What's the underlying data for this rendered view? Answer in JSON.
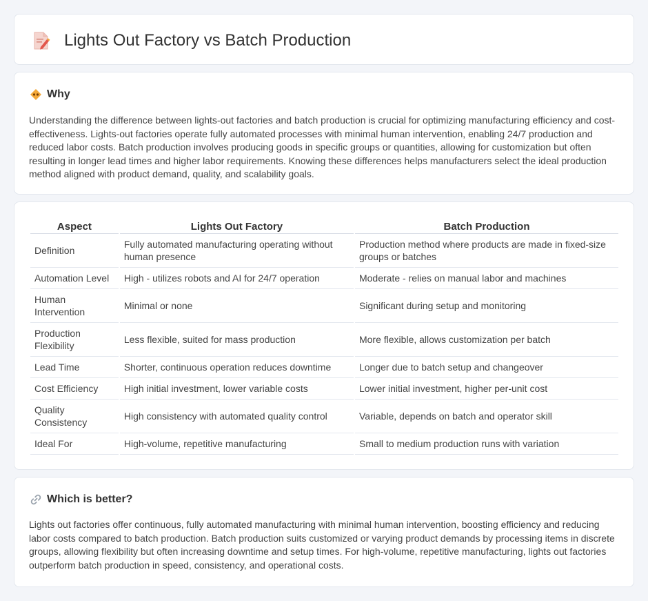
{
  "header": {
    "title": "Lights Out Factory vs Batch Production",
    "icon": "document-pencil-icon"
  },
  "why": {
    "icon": "why-diamond-icon",
    "title": "Why",
    "text": "Understanding the difference between lights-out factories and batch production is crucial for optimizing manufacturing efficiency and cost-effectiveness. Lights-out factories operate fully automated processes with minimal human intervention, enabling 24/7 production and reduced labor costs. Batch production involves producing goods in specific groups or quantities, allowing for customization but often resulting in longer lead times and higher labor requirements. Knowing these differences helps manufacturers select the ideal production method aligned with product demand, quality, and scalability goals."
  },
  "table": {
    "headers": [
      "Aspect",
      "Lights Out Factory",
      "Batch Production"
    ],
    "rows": [
      [
        "Definition",
        "Fully automated manufacturing operating without human presence",
        "Production method where products are made in fixed-size groups or batches"
      ],
      [
        "Automation Level",
        "High - utilizes robots and AI for 24/7 operation",
        "Moderate - relies on manual labor and machines"
      ],
      [
        "Human Intervention",
        "Minimal or none",
        "Significant during setup and monitoring"
      ],
      [
        "Production Flexibility",
        "Less flexible, suited for mass production",
        "More flexible, allows customization per batch"
      ],
      [
        "Lead Time",
        "Shorter, continuous operation reduces downtime",
        "Longer due to batch setup and changeover"
      ],
      [
        "Cost Efficiency",
        "High initial investment, lower variable costs",
        "Lower initial investment, higher per-unit cost"
      ],
      [
        "Quality Consistency",
        "High consistency with automated quality control",
        "Variable, depends on batch and operator skill"
      ],
      [
        "Ideal For",
        "High-volume, repetitive manufacturing",
        "Small to medium production runs with variation"
      ]
    ]
  },
  "better": {
    "icon": "link-icon",
    "title": "Which is better?",
    "text": "Lights out factories offer continuous, fully automated manufacturing with minimal human intervention, boosting efficiency and reducing labor costs compared to batch production. Batch production suits customized or varying product demands by processing items in discrete groups, allowing flexibility but often increasing downtime and setup times. For high-volume, repetitive manufacturing, lights out factories outperform batch production in speed, consistency, and operational costs."
  }
}
